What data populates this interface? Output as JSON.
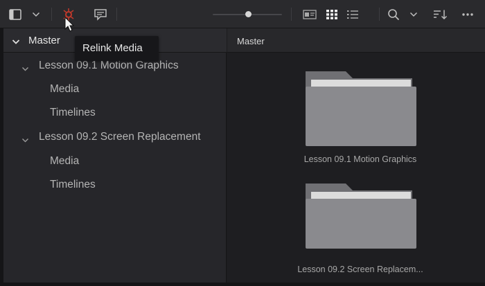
{
  "toolbar": {
    "buttons": [
      {
        "name": "panel-layout-icon"
      },
      {
        "name": "chevron-down-icon"
      },
      {
        "name": "relink-media-icon"
      },
      {
        "name": "caption-icon"
      },
      {
        "name": "metadata-view-icon"
      },
      {
        "name": "thumbnail-view-icon"
      },
      {
        "name": "list-view-icon"
      },
      {
        "name": "search-icon"
      },
      {
        "name": "sort-icon"
      },
      {
        "name": "more-options-icon"
      }
    ],
    "thumbnail_size_slider": 0.47
  },
  "tooltip": {
    "text": "Relink Media"
  },
  "sidebar": {
    "root_label": "Master",
    "bins": [
      {
        "label": "Lesson 09.1 Motion Graphics",
        "children": [
          "Media",
          "Timelines"
        ]
      },
      {
        "label": "Lesson 09.2 Screen Replacement",
        "children": [
          "Media",
          "Timelines"
        ]
      }
    ]
  },
  "main": {
    "header": "Master",
    "folders": [
      {
        "label": "Lesson 09.1 Motion Graphics"
      },
      {
        "label": "Lesson 09.2 Screen Replacem..."
      }
    ]
  },
  "colors": {
    "relink_icon": "#c0392b",
    "folder_body": "#8a8a8e",
    "folder_tab": "#707074"
  }
}
